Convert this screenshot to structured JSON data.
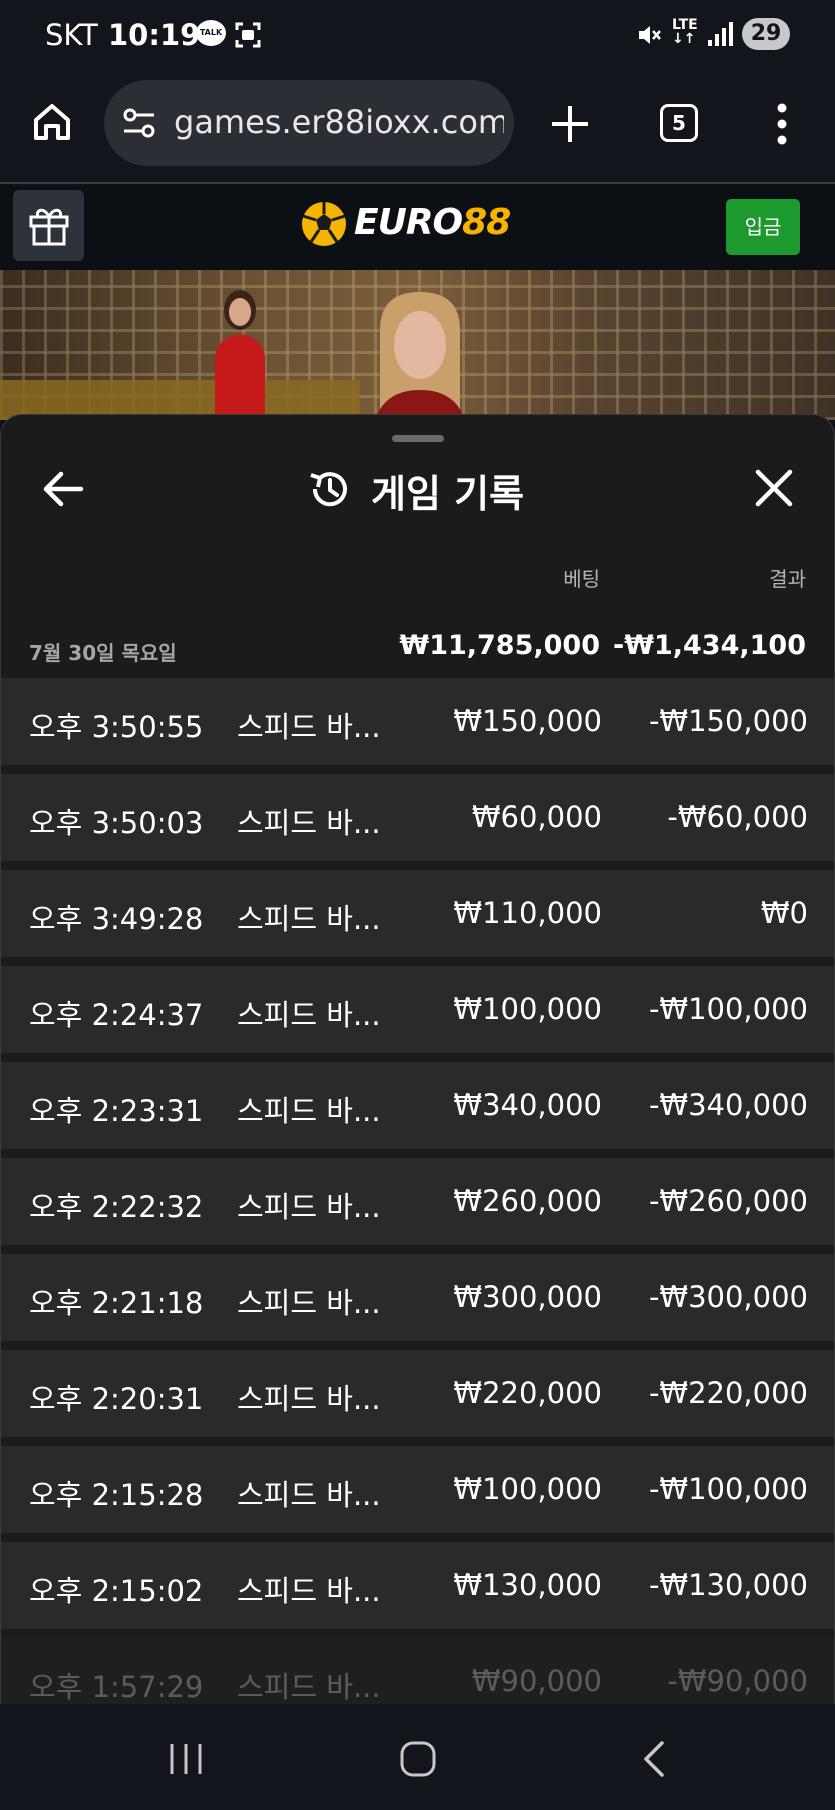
{
  "status_bar": {
    "carrier": "SKT",
    "time": "10:19",
    "talk_badge": "TALK",
    "network": "LTE",
    "battery": "29"
  },
  "browser": {
    "url": "games.er88ioxx.com",
    "tab_count": "5"
  },
  "site_header": {
    "logo_part1": "EURO",
    "logo_part2": "88",
    "deposit_label": "입금"
  },
  "sheet": {
    "title": "게임 기록",
    "col_bet": "베팅",
    "col_result": "결과",
    "date_label": "7월 30일 목요일",
    "total_bet": "₩11,785,000",
    "total_result": "-₩1,434,100",
    "rows": [
      {
        "time": "오후 3:50:55",
        "game": "스피드 바...",
        "bet": "₩150,000",
        "result": "-₩150,000"
      },
      {
        "time": "오후 3:50:03",
        "game": "스피드 바...",
        "bet": "₩60,000",
        "result": "-₩60,000"
      },
      {
        "time": "오후 3:49:28",
        "game": "스피드 바...",
        "bet": "₩110,000",
        "result": "₩0"
      },
      {
        "time": "오후 2:24:37",
        "game": "스피드 바...",
        "bet": "₩100,000",
        "result": "-₩100,000"
      },
      {
        "time": "오후 2:23:31",
        "game": "스피드 바...",
        "bet": "₩340,000",
        "result": "-₩340,000"
      },
      {
        "time": "오후 2:22:32",
        "game": "스피드 바...",
        "bet": "₩260,000",
        "result": "-₩260,000"
      },
      {
        "time": "오후 2:21:18",
        "game": "스피드 바...",
        "bet": "₩300,000",
        "result": "-₩300,000"
      },
      {
        "time": "오후 2:20:31",
        "game": "스피드 바...",
        "bet": "₩220,000",
        "result": "-₩220,000"
      },
      {
        "time": "오후 2:15:28",
        "game": "스피드 바...",
        "bet": "₩100,000",
        "result": "-₩100,000"
      },
      {
        "time": "오후 2:15:02",
        "game": "스피드 바...",
        "bet": "₩130,000",
        "result": "-₩130,000"
      },
      {
        "time": "오후 1:57:29",
        "game": "스피드 바...",
        "bet": "₩90,000",
        "result": "-₩90,000"
      }
    ]
  },
  "icons": {
    "home": "home-icon",
    "tune": "tune-icon",
    "plus": "plus-icon",
    "menu": "more-vert-icon",
    "gift": "gift-icon",
    "back": "arrow-left-icon",
    "history": "history-icon",
    "close": "close-icon",
    "nav_recent": "recent-apps-icon",
    "nav_home": "nav-home-icon",
    "nav_back": "nav-back-icon"
  },
  "colors": {
    "background": "#0f1218",
    "sheet": "#1b1b1c",
    "row": "#2a2a2b",
    "deposit_green": "#1d9a2f",
    "logo_gold": "#f5b400"
  }
}
